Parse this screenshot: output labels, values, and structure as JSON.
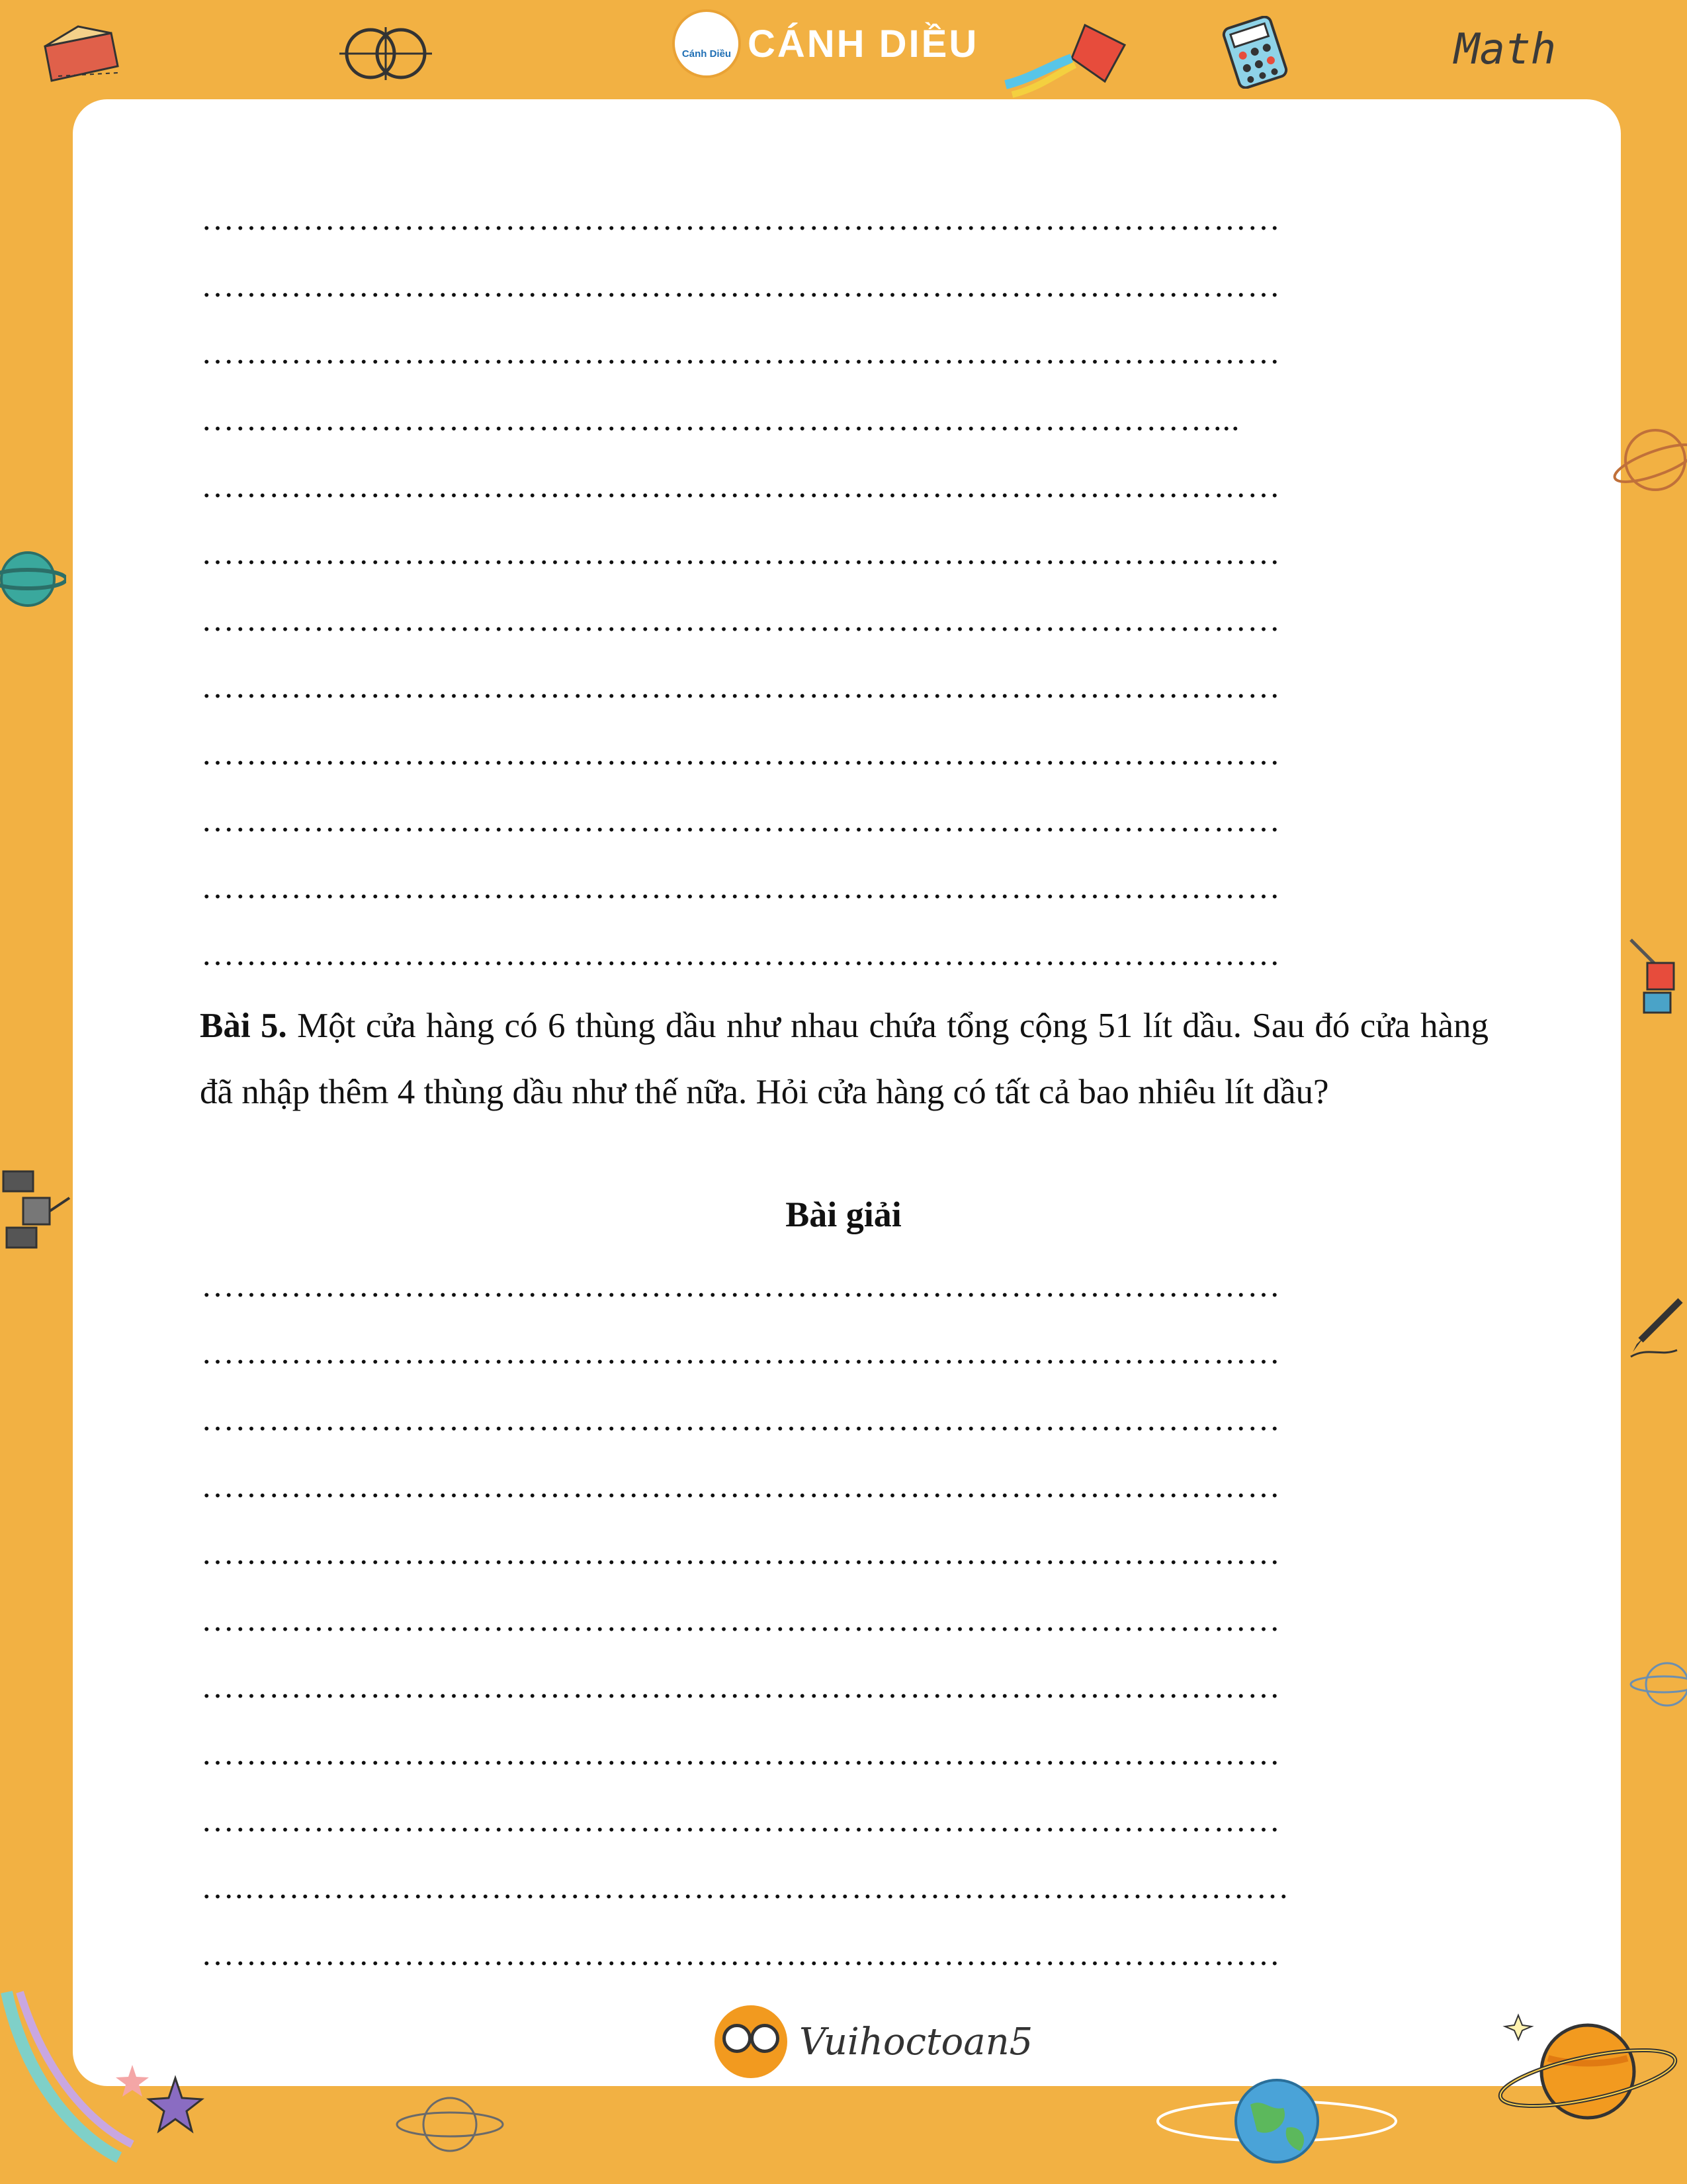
{
  "header": {
    "brand_logo_text": "Cánh Diều",
    "brand_title": "CÁNH DIỀU",
    "math_label": "Math"
  },
  "answer_lines_top": [
    "……………………………………………………………………………………",
    "……………………………………………………………………………………",
    "……………………………………………………………………………………",
    "………………………………………………………………………………...",
    "……………………………………………………………………………………",
    "……………………………………………………………………………………",
    "……………………………………………………………………………………",
    "……………………………………………………………………………………",
    "……………………………………………………………………………………",
    "……………………………………………………………………………………",
    "……………………………………………………………………………………",
    "……………………………………………………………………………………"
  ],
  "problem": {
    "number": "Bài 5.",
    "text": " Một cửa hàng có 6 thùng dầu như nhau chứa tổng cộng 51 lít dầu. Sau đó cửa hàng đã nhập thêm 4 thùng dầu như thế nữa. Hỏi cửa hàng có tất cả bao nhiêu lít dầu?"
  },
  "solution_title": "Bài giải",
  "answer_lines_bottom": [
    "……………………………………………………………………………………",
    "……………………………………………………………………………………",
    "……………………………………………………………………………………",
    "……………………………………………………………………………………",
    "……………………………………………………………………………………",
    "……………………………………………………………………………………",
    "……………………………………………………………………………………",
    "……………………………………………………………………………………",
    "……………………………………………………………………………………",
    "….…………………………………………………………………………………",
    "……………………………………………………………………………………"
  ],
  "footer": {
    "brand": "Vuihoctoan5"
  },
  "colors": {
    "frame": "#f2b143",
    "page": "#ffffff",
    "text": "#111111"
  },
  "icons": [
    "ruler-icon",
    "venn-diagram-icon",
    "kite-icon",
    "calculator-icon",
    "planet-icon",
    "satellite-icon",
    "pencil-icon",
    "shooting-star-icon",
    "saturn-icon",
    "earth-icon"
  ]
}
